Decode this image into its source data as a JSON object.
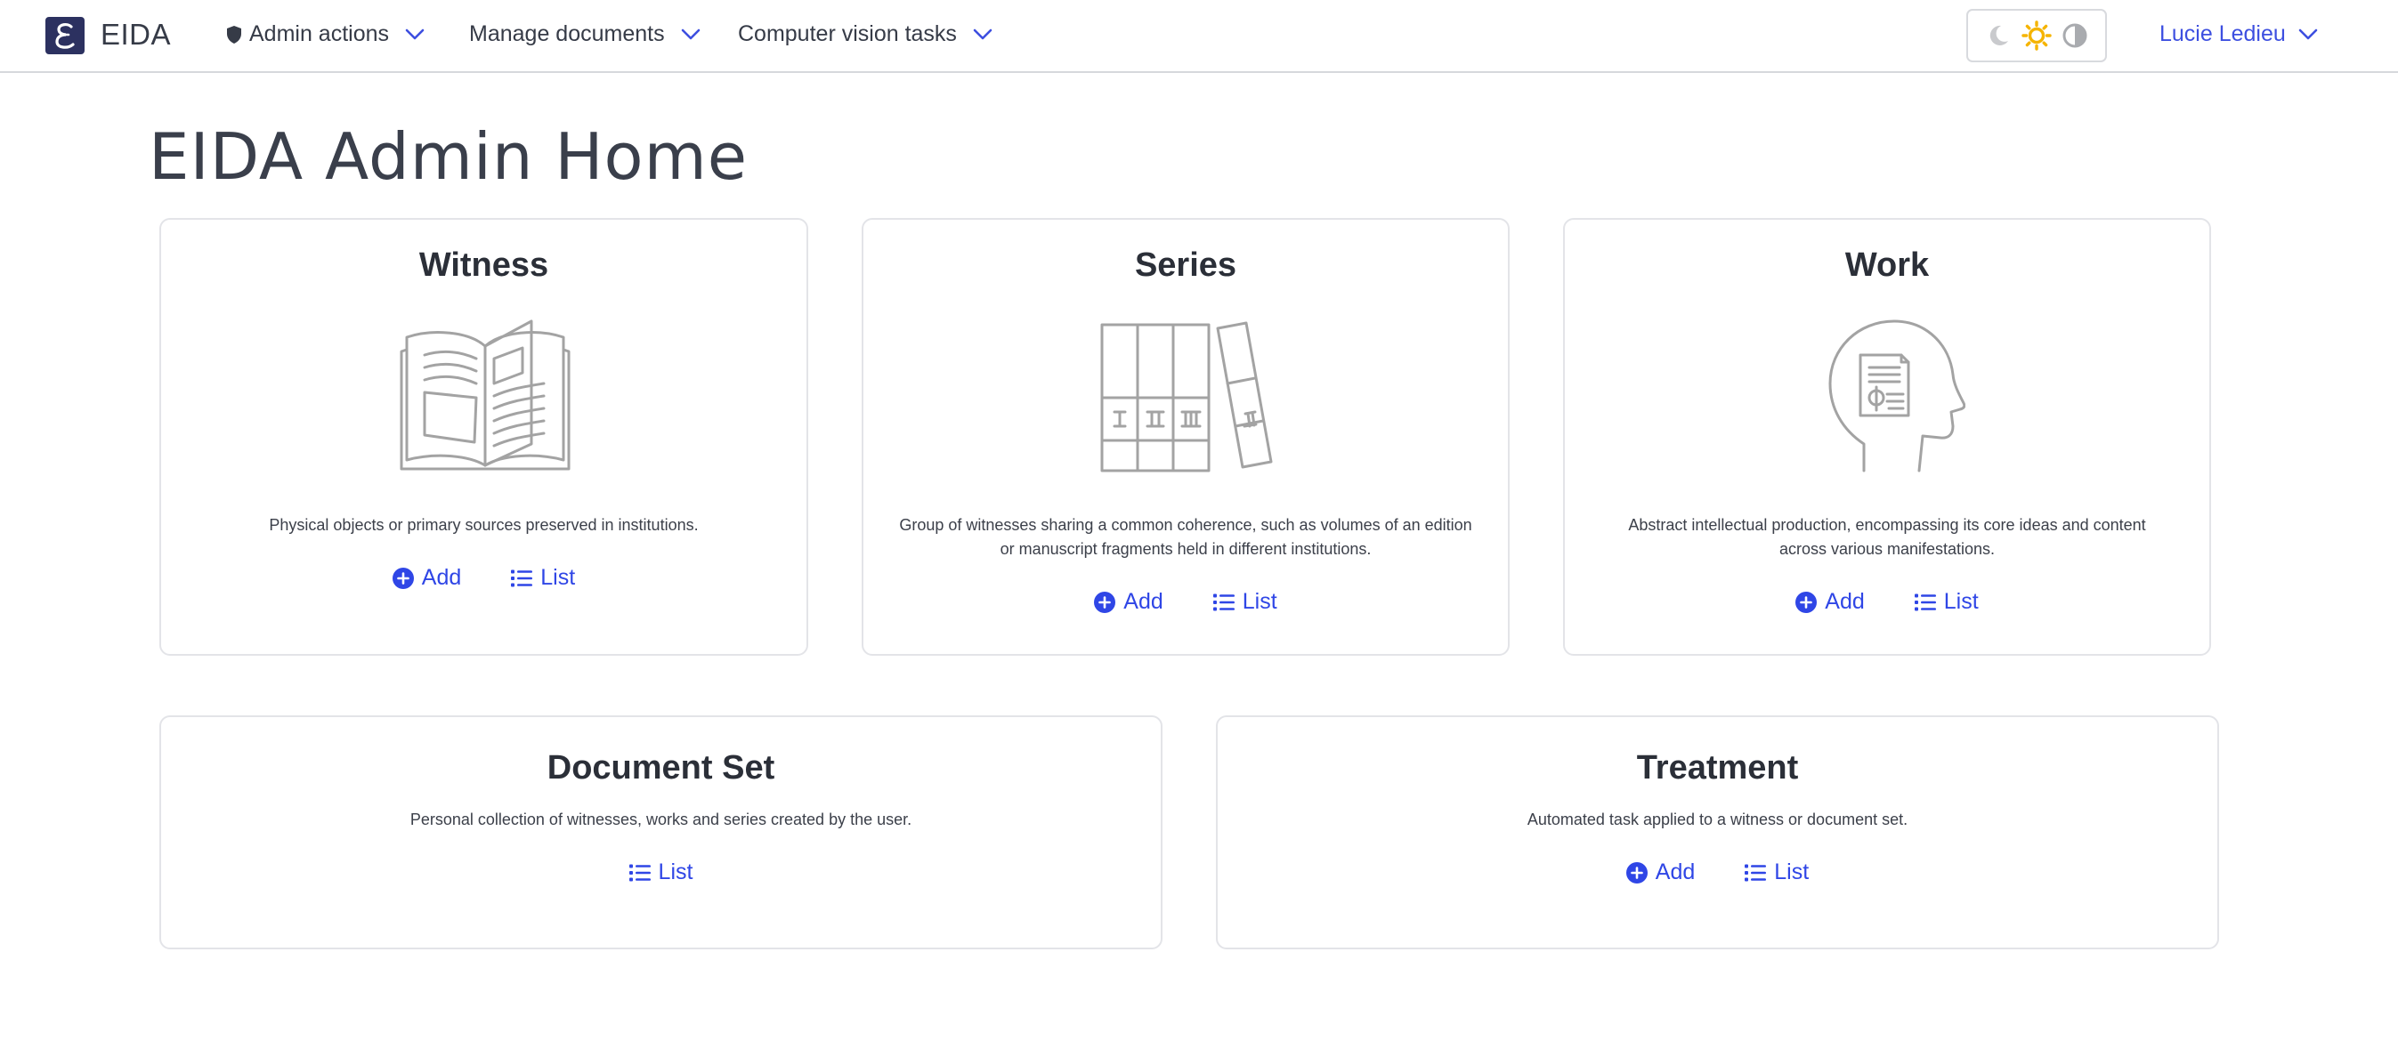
{
  "nav": {
    "brand": "EIDA",
    "admin_actions": "Admin actions",
    "manage_documents": "Manage documents",
    "computer_vision_tasks": "Computer vision tasks",
    "user_name": "Lucie Ledieu"
  },
  "page": {
    "title": "EIDA Admin Home"
  },
  "cards": {
    "witness": {
      "title": "Witness",
      "description": "Physical objects or primary sources preserved in institutions.",
      "add_label": "Add",
      "list_label": "List"
    },
    "series": {
      "title": "Series",
      "description_line1": "Group of witnesses sharing a common coherence, such as volumes of an edition",
      "description_line2": "or manuscript fragments held in different institutions.",
      "add_label": "Add",
      "list_label": "List"
    },
    "work": {
      "title": "Work",
      "description_line1": "Abstract intellectual production, encompassing its core ideas and content",
      "description_line2": "across various manifestations.",
      "add_label": "Add",
      "list_label": "List"
    },
    "document_set": {
      "title": "Document Set",
      "description": "Personal collection of witnesses, works and series created by the user.",
      "list_label": "List"
    },
    "treatment": {
      "title": "Treatment",
      "description": "Automated task applied to a witness or document set.",
      "add_label": "Add",
      "list_label": "List"
    }
  },
  "icons": {
    "logo": "eida-logo-icon",
    "shield": "shield-icon",
    "chevron": "chevron-down-icon",
    "moon": "moon-icon",
    "sun": "sun-icon",
    "contrast": "contrast-icon",
    "add": "plus-circle-icon",
    "list": "list-icon",
    "witness": "open-book-icon",
    "series": "book-volumes-icon",
    "work": "head-document-icon"
  },
  "colors": {
    "accent": "#2f46e6",
    "user_link": "#3d4fe0",
    "logo_bg": "#2c3160",
    "sun_active": "#f5b400",
    "illustration_stroke": "#a3a3a3"
  }
}
